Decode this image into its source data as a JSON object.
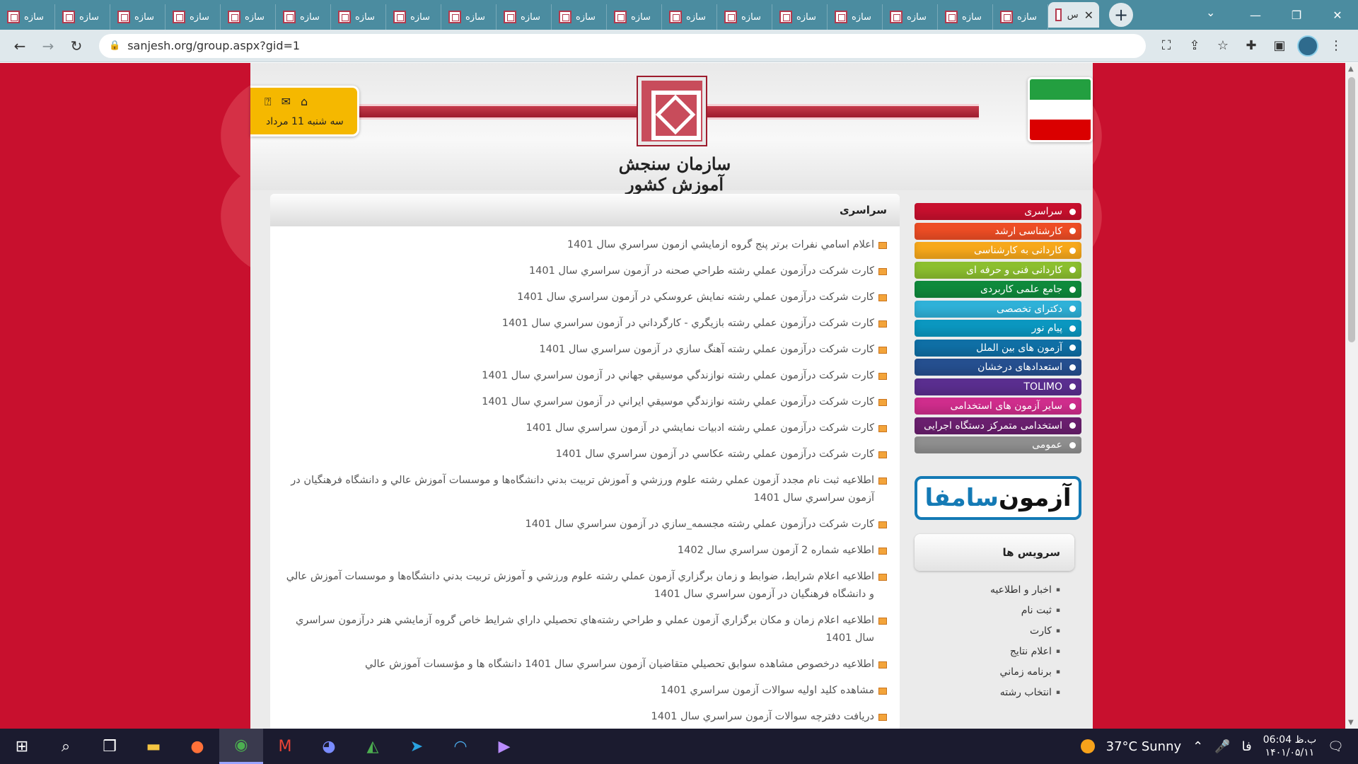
{
  "browser": {
    "tab_label": "سازه",
    "tab_count": 19,
    "active_tab_label": "س",
    "close_glyph": "✕",
    "new_tab_glyph": "+",
    "url": "sanjesh.org/group.aspx?gid=1"
  },
  "header": {
    "site_name": "سازمان سنجش آموزش کشور",
    "date": "سه شنبه 11 مرداد",
    "icons": [
      "help-icon",
      "mail-icon",
      "home-icon"
    ]
  },
  "main": {
    "title": "سراسری",
    "news": [
      "اعلام اسامي نفرات برتر پنج گروه ازمايشي ازمون سراسري سال 1401",
      "كارت شركت درآزمون عملي رشته طراحي صحنه در آزمون سراسري سال 1401",
      "كارت شركت درآزمون عملي رشته نمايش عروسكي در آزمون سراسري سال 1401",
      "كارت شركت درآزمون عملي رشته بازيگري - كارگرداني در آزمون سراسري سال 1401",
      "كارت شركت درآزمون عملي رشته آهنگ سازي در آزمون سراسري سال 1401",
      "كارت شركت درآزمون عملي رشته نوازندگي موسيقي جهاني در آزمون سراسري سال 1401",
      "كارت شركت درآزمون عملي رشته نوازندگي موسيقي ايراني در آزمون سراسري سال 1401",
      "كارت شركت درآزمون عملي رشته ادبيات نمايشي در آزمون سراسري سال 1401",
      "كارت شركت درآزمون عملي رشته عكاسي در آزمون سراسري سال 1401",
      "اطلاعيه ثبت نام مجدد آزمون عملي رشته علوم ورزشي و آموزش تربيت بدني دانشگاه‌ها و موسسات آموزش عالي و دانشگاه فرهنگيان در آزمون سراسري سال 1401",
      "كارت شركت درآزمون عملي رشته مجسمه_سازي در آزمون سراسري سال 1401",
      "اطلاعيه شماره 2 آزمون سراسري سال 1402",
      "اطلاعيه اعلام شرايط، ضوابط و زمان برگزاري آزمون عملي رشته علوم ورزشي و آموزش تربيت بدني دانشگاه‌ها و موسسات آموزش عالي و دانشگاه فرهنگيان در آزمون سراسري سال 1401",
      "اطلاعيه اعلام زمان و مكان برگزاري آزمون عملي و طراحي رشته‌هاي تحصيلي داراي شرايط خاص گروه آزمايشي هنر درآزمون سراسري سال 1401",
      "اطلاعيه درخصوص مشاهده سوابق تحصيلي متقاضيان آزمون سراسري سال 1401 دانشگاه ها و مؤسسات آموزش عالي",
      "مشاهده كليد اوليه سوالات آزمون سراسري 1401",
      "دريافت دفترچه سوالات آزمون سراسري سال 1401"
    ]
  },
  "sidebar": {
    "menu": [
      {
        "label": "سراسری",
        "color": "#c8102e"
      },
      {
        "label": "کارشناسی ارشد",
        "color": "#ee4d25"
      },
      {
        "label": "کاردانی به کارشناسی",
        "color": "#f7a81b"
      },
      {
        "label": "کاردانی فنی و حرفه ای",
        "color": "#8cbf2f"
      },
      {
        "label": "جامع علمی کاربردی",
        "color": "#0f8a3c"
      },
      {
        "label": "دکترای تخصصی",
        "color": "#2fb1d8"
      },
      {
        "label": "پیام نور",
        "color": "#0b97c0"
      },
      {
        "label": "آزمون های بین الملل",
        "color": "#0f6fa5"
      },
      {
        "label": "استعدادهای درخشان",
        "color": "#254f8f"
      },
      {
        "label": "TOLIMO",
        "color": "#5a2e8f"
      },
      {
        "label": "سایر آزمون های استخدامی",
        "color": "#cf2d8c"
      },
      {
        "label": "استخدامی متمرکز دستگاه اجرایی",
        "color": "#6a1f6e"
      },
      {
        "label": "عمومی",
        "color": "#8f8f8f"
      }
    ],
    "ad": {
      "part1": "آزمون",
      "part2": "سامفا"
    },
    "services_title": "سرویس ها",
    "services": [
      "اخبار و اطلاعیه",
      "ثبت نام",
      "کارت",
      "اعلام نتايج",
      "برنامه زماني",
      "انتخاب رشته"
    ]
  },
  "taskbar": {
    "weather": "37°C  Sunny",
    "lang": "فا",
    "time": "06:04 ب.ظ",
    "date": "۱۴۰۱/۰۵/۱۱"
  }
}
